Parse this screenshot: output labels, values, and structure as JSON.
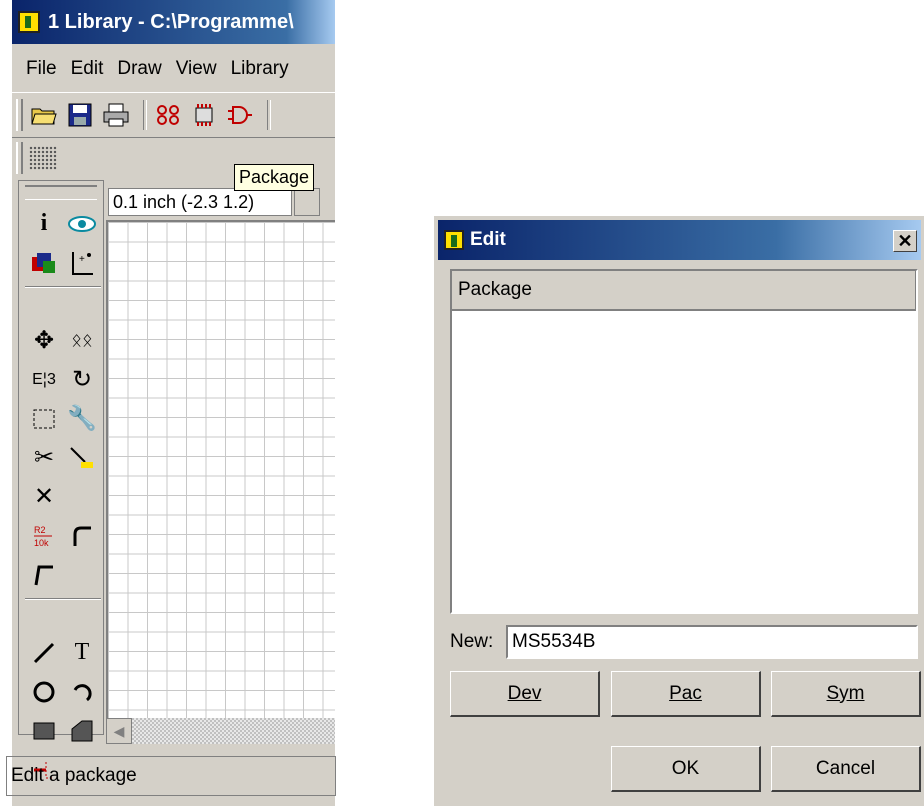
{
  "library_window": {
    "title": "1 Library - C:\\Programme\\",
    "menu": [
      "File",
      "Edit",
      "Draw",
      "View",
      "Library"
    ],
    "toolbar_icons": [
      "open-folder-icon",
      "save-icon",
      "print-icon",
      "schematic-icon",
      "package-icon",
      "symbol-icon"
    ],
    "tooltip": "Package",
    "coordinate_readout": "0.1 inch (-2.3 1.2)",
    "status": "Edit a package"
  },
  "edit_dialog": {
    "title": "Edit",
    "close_label": "✕",
    "list_header": "Package",
    "new_label": "New:",
    "new_value": "MS5534B",
    "buttons": {
      "dev": "Dev",
      "pac": "Pac",
      "sym": "Sym",
      "ok": "OK",
      "cancel": "Cancel"
    }
  },
  "colors": {
    "titlebar_start": "#0a246a",
    "face": "#d4d0c8"
  }
}
